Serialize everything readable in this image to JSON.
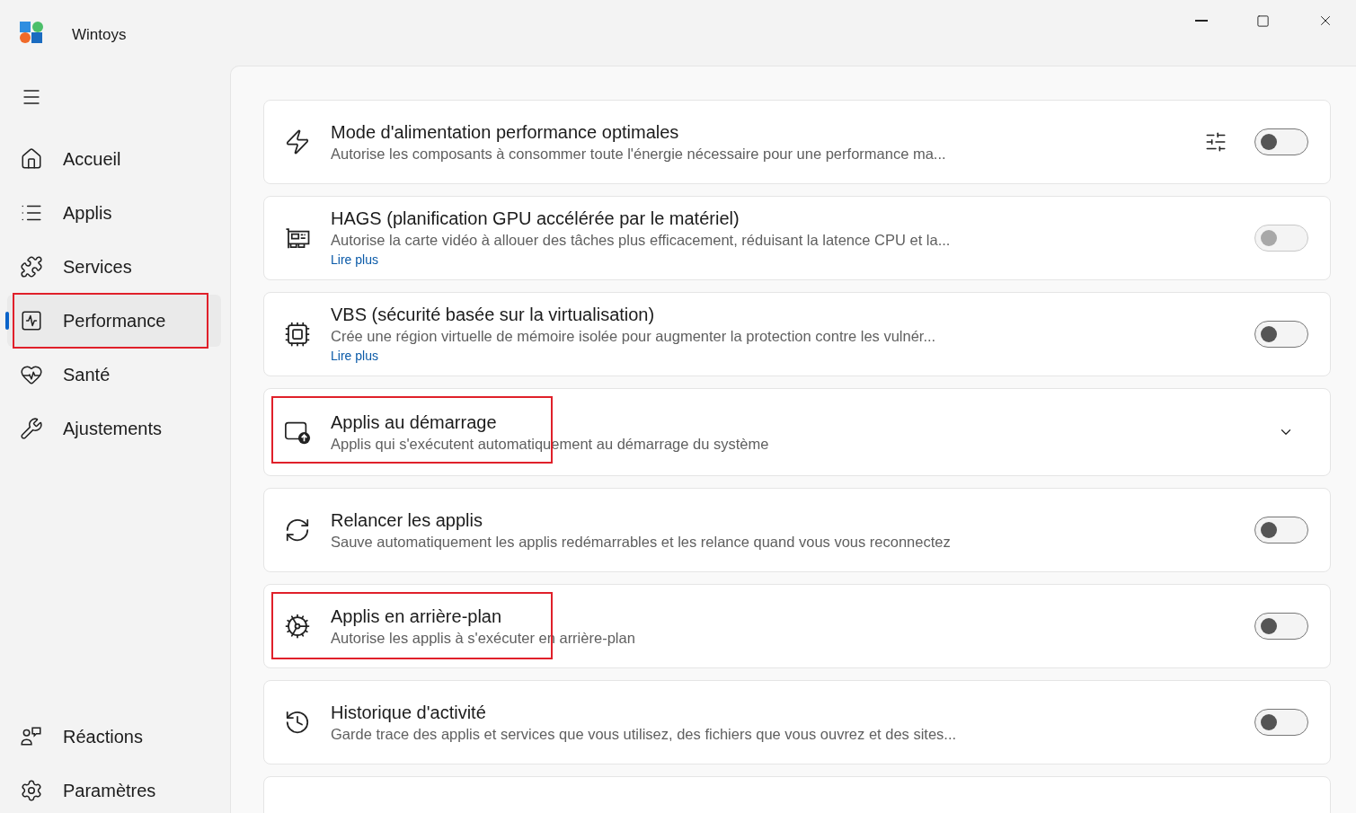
{
  "window": {
    "title": "Wintoys"
  },
  "sidebar": {
    "items": [
      {
        "label": "Accueil",
        "selected": false,
        "highlighted": false
      },
      {
        "label": "Applis",
        "selected": false,
        "highlighted": false
      },
      {
        "label": "Services",
        "selected": false,
        "highlighted": false
      },
      {
        "label": "Performance",
        "selected": true,
        "highlighted": true
      },
      {
        "label": "Santé",
        "selected": false,
        "highlighted": false
      },
      {
        "label": "Ajustements",
        "selected": false,
        "highlighted": false
      }
    ],
    "footer_items": [
      {
        "label": "Réactions",
        "selected": false,
        "highlighted": false
      },
      {
        "label": "Paramètres",
        "selected": false,
        "highlighted": false
      }
    ]
  },
  "settings": [
    {
      "kind": "toggle",
      "title": "Mode d'alimentation performance optimales",
      "description": "Autorise les composants à consommer toute l'énergie nécessaire pour une performance ma...",
      "has_options": true,
      "on": false,
      "disabled": false,
      "highlighted": false
    },
    {
      "kind": "toggle",
      "title": "HAGS (planification GPU accélérée par le matériel)",
      "description": "Autorise la carte vidéo à allouer des tâches plus efficacement, réduisant la latence CPU et la...",
      "link": "Lire plus",
      "on": false,
      "disabled": true,
      "highlighted": false
    },
    {
      "kind": "toggle",
      "title": "VBS (sécurité basée sur la virtualisation)",
      "description": "Crée une région virtuelle de mémoire isolée pour augmenter la protection contre les vulnér...",
      "link": "Lire plus",
      "on": false,
      "disabled": false,
      "highlighted": false
    },
    {
      "kind": "expander",
      "title": "Applis au démarrage",
      "description": "Applis qui s'exécutent automatiquement au démarrage du système",
      "expanded": false,
      "highlighted": true
    },
    {
      "kind": "toggle",
      "title": "Relancer les applis",
      "description": "Sauve automatiquement les applis redémarrables et les relance quand vous vous reconnectez",
      "on": false,
      "disabled": false,
      "highlighted": false
    },
    {
      "kind": "toggle",
      "title": "Applis en arrière-plan",
      "description": "Autorise les applis à s'exécuter en arrière-plan",
      "on": false,
      "disabled": false,
      "highlighted": true
    },
    {
      "kind": "toggle",
      "title": "Historique d'activité",
      "description": "Garde trace des applis et services que vous utilisez, des fichiers que vous ouvrez et des sites...",
      "on": false,
      "disabled": false,
      "highlighted": false
    },
    {
      "kind": "partial"
    }
  ]
}
